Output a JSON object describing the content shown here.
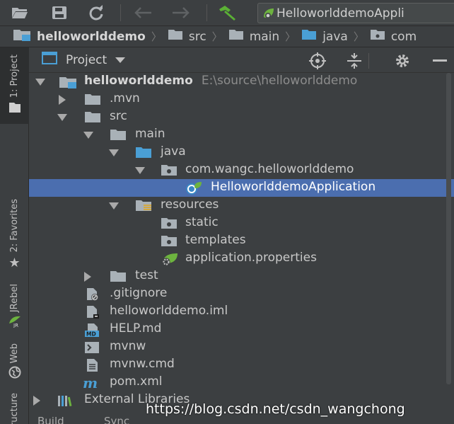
{
  "toolbar": {
    "run_config_label": "HelloworlddemoAppli",
    "icons": [
      "folder-open-icon",
      "save-icon",
      "sync-icon",
      "back-icon",
      "forward-icon",
      "build-hammer-icon",
      "spring-boot-icon"
    ]
  },
  "breadcrumb": {
    "items": [
      "helloworlddemo",
      "src",
      "main",
      "java",
      "com"
    ]
  },
  "left_strip": {
    "project_tab": "1: Project",
    "favorites_tab": "2: Favorites",
    "jrebel_tab": "JRebel",
    "web_tab": "Web",
    "structure_tab": "Structure"
  },
  "project_panel": {
    "title": "Project",
    "icons": [
      "locate-icon",
      "collapse-icon",
      "settings-gear-icon",
      "minimize-icon"
    ]
  },
  "tree": {
    "root": {
      "name": "helloworlddemo",
      "path": "E:\\source\\helloworlddemo"
    },
    "mvn": ".mvn",
    "src": "src",
    "main": "main",
    "java": "java",
    "package": "com.wangc.helloworlddemo",
    "app_class": "HelloworlddemoApplication",
    "resources": "resources",
    "static": "static",
    "templates": "templates",
    "app_props": "application.properties",
    "test": "test",
    "gitignore": ".gitignore",
    "iml": "helloworlddemo.iml",
    "help": "HELP.md",
    "mvnw": "mvnw",
    "mvnw_cmd": "mvnw.cmd",
    "pom": "pom.xml",
    "external": "External Libraries"
  },
  "bottom": {
    "build": "Build",
    "sync": "Sync"
  },
  "watermark": "https://blog.csdn.net/csdn_wangchong",
  "colors": {
    "background": "#3c3f41",
    "selection": "#4b6eaf",
    "folder": "#a9b1b7",
    "source_folder": "#4a9fd5",
    "spring_green": "#6db33f"
  }
}
